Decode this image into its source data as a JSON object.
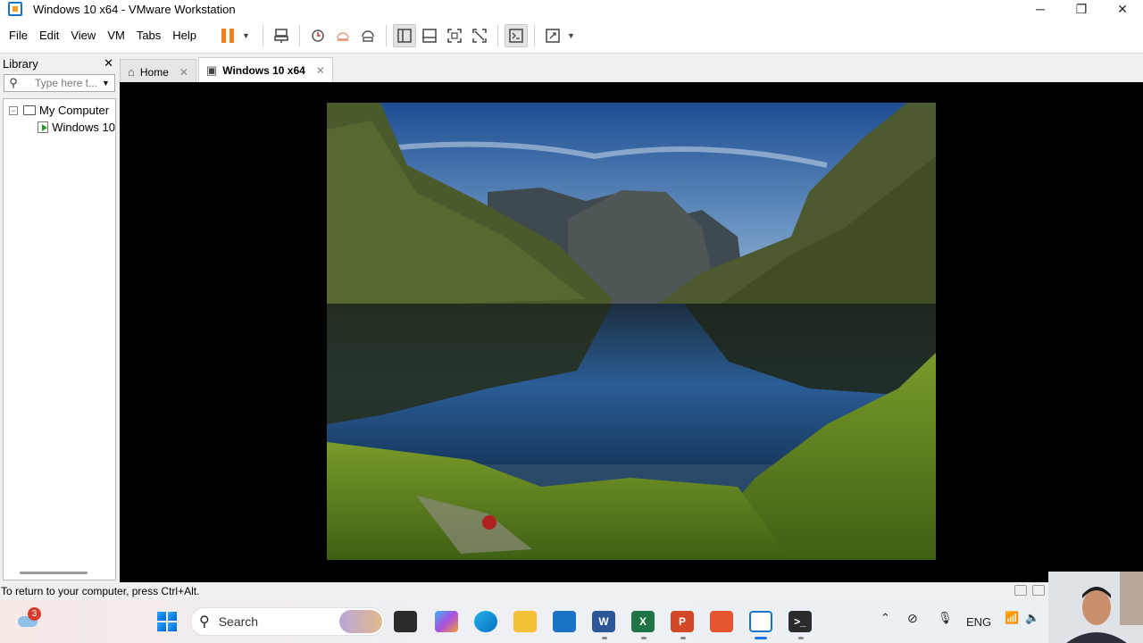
{
  "window": {
    "title": "Windows 10 x64 - VMware Workstation",
    "controls": {
      "minimize": "─",
      "restore": "❐",
      "close": "✕"
    }
  },
  "menu": [
    "File",
    "Edit",
    "View",
    "VM",
    "Tabs",
    "Help"
  ],
  "library": {
    "title": "Library",
    "close": "✕",
    "search_placeholder": "Type here t...",
    "tree": {
      "root": "My Computer",
      "children": [
        "Windows 10"
      ]
    }
  },
  "tabs": [
    {
      "label": "Home",
      "icon": "home-icon",
      "close": "✕",
      "active": false
    },
    {
      "label": "Windows 10 x64",
      "icon": "vm-icon",
      "close": "✕",
      "active": true
    }
  ],
  "status": {
    "message": "To return to your computer, press Ctrl+Alt."
  },
  "taskbar": {
    "notification_count": "3",
    "search_label": "Search",
    "apps": [
      "task-view",
      "copilot",
      "edge",
      "file-explorer",
      "microsoft-store",
      "word",
      "excel",
      "powerpoint",
      "snip",
      "vmware",
      "terminal"
    ],
    "tray": {
      "language": "ENG"
    }
  },
  "colors": {
    "accent": "#f08020",
    "vm_background": "#000000",
    "taskbar_active": "#1a73e8"
  }
}
